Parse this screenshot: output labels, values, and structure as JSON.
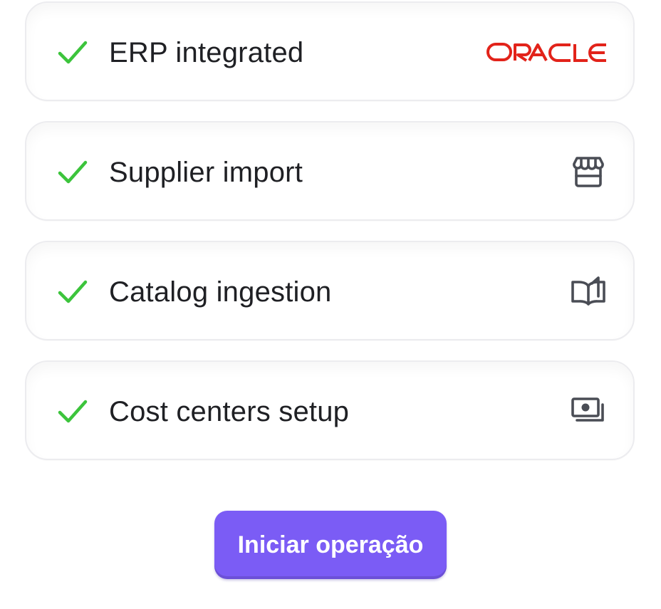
{
  "steps": [
    {
      "label": "ERP integrated",
      "status": "done",
      "icon": "oracle-logo",
      "logo_text": "ORACLE"
    },
    {
      "label": "Supplier import",
      "status": "done",
      "icon": "storefront-icon"
    },
    {
      "label": "Catalog ingestion",
      "status": "done",
      "icon": "book-open-icon"
    },
    {
      "label": "Cost centers setup",
      "status": "done",
      "icon": "money-icon"
    }
  ],
  "action": {
    "start_label": "Iniciar operação"
  },
  "colors": {
    "check": "#3cc43c",
    "oracle_red": "#e2231a",
    "icon_gray": "#4a4d55",
    "button": "#7b5cf5",
    "text": "#1f2024"
  }
}
